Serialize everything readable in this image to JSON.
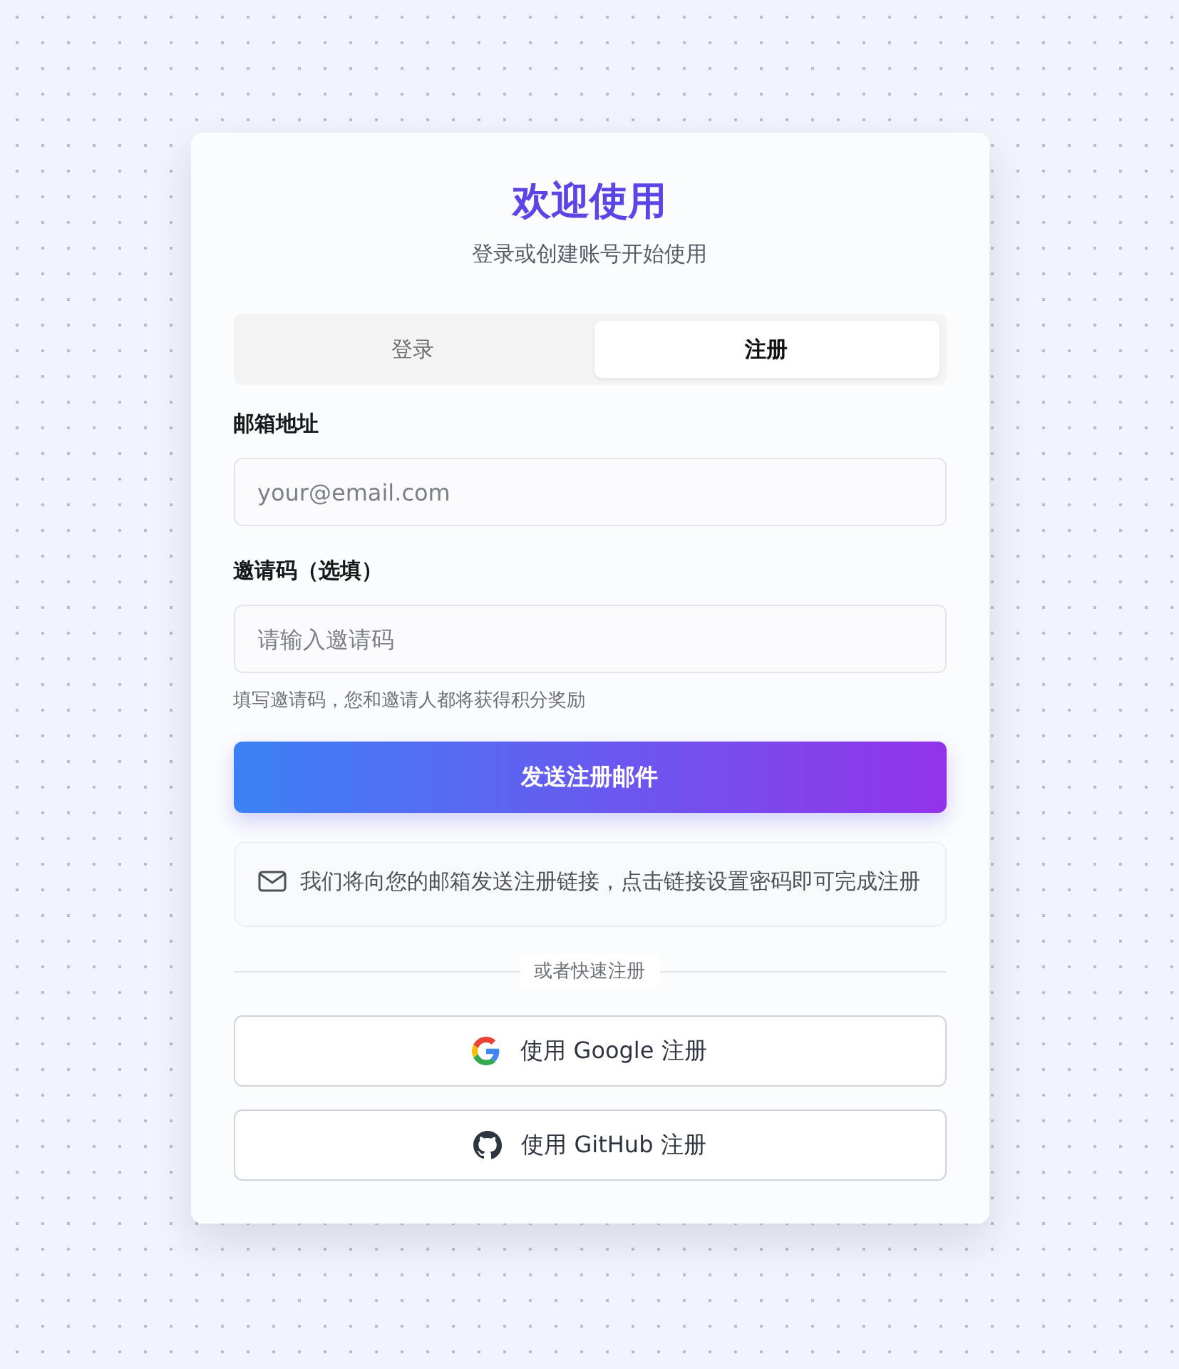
{
  "title": "欢迎使用",
  "subtitle": "登录或创建账号开始使用",
  "tabs": [
    {
      "label": "登录",
      "selected": false
    },
    {
      "label": "注册",
      "selected": true
    }
  ],
  "fields": [
    {
      "label": "邮箱地址",
      "placeholder": "your@email.com"
    },
    {
      "label": "邀请码（选填）",
      "placeholder": "请输入邀请码",
      "hint": "填写邀请码，您和邀请人都将获得积分奖励"
    }
  ],
  "submit": "发送注册邮件",
  "notice": "我们将向您的邮箱发送注册链接，点击链接设置密码即可完成注册",
  "divider": "或者快速注册",
  "social": [
    {
      "kind": "google",
      "label": "使用 Google 注册"
    },
    {
      "kind": "github",
      "label": "使用 GitHub 注册"
    }
  ]
}
